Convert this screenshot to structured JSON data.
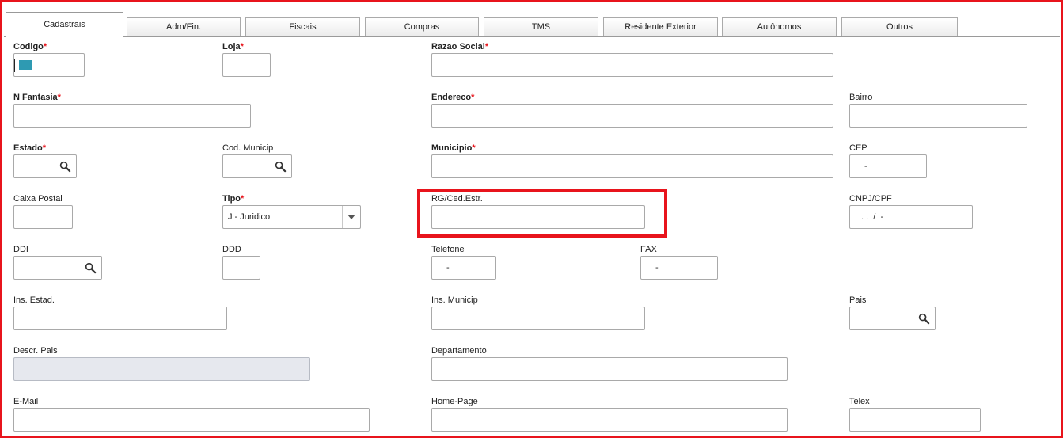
{
  "tabs": [
    {
      "label": "Cadastrais"
    },
    {
      "label": "Adm/Fin."
    },
    {
      "label": "Fiscais"
    },
    {
      "label": "Compras"
    },
    {
      "label": "TMS"
    },
    {
      "label": "Residente Exterior"
    },
    {
      "label": "Autônomos"
    },
    {
      "label": "Outros"
    }
  ],
  "active_tab": "Cadastrais",
  "required_mark": "*",
  "colors": {
    "highlight": "#e8141c",
    "required": "#e8141c",
    "codigo_swatch": "#2e9ab2"
  },
  "fields": {
    "codigo": {
      "label": "Codigo",
      "value": ""
    },
    "loja": {
      "label": "Loja",
      "value": ""
    },
    "razao_social": {
      "label": "Razao Social",
      "value": ""
    },
    "n_fantasia": {
      "label": "N Fantasia",
      "value": ""
    },
    "endereco": {
      "label": "Endereco",
      "value": ""
    },
    "bairro": {
      "label": "Bairro",
      "value": ""
    },
    "estado": {
      "label": "Estado",
      "value": ""
    },
    "cod_municip": {
      "label": "Cod. Municip",
      "value": ""
    },
    "municipio": {
      "label": "Municipio",
      "value": ""
    },
    "cep": {
      "label": "CEP",
      "value": "-"
    },
    "caixa_postal": {
      "label": "Caixa Postal",
      "value": ""
    },
    "tipo": {
      "label": "Tipo",
      "value": "J - Juridico"
    },
    "rg_ced_estr": {
      "label": "RG/Ced.Estr.",
      "value": ""
    },
    "cnpj_cpf": {
      "label": "CNPJ/CPF",
      "value": ". .  /  -"
    },
    "ddi": {
      "label": "DDI",
      "value": ""
    },
    "ddd": {
      "label": "DDD",
      "value": ""
    },
    "telefone": {
      "label": "Telefone",
      "value": "-"
    },
    "fax": {
      "label": "FAX",
      "value": "-"
    },
    "ins_estad": {
      "label": "Ins. Estad.",
      "value": ""
    },
    "ins_municip": {
      "label": "Ins. Municip",
      "value": ""
    },
    "pais": {
      "label": "Pais",
      "value": ""
    },
    "descr_pais": {
      "label": "Descr. Pais",
      "value": ""
    },
    "departamento": {
      "label": "Departamento",
      "value": ""
    },
    "email": {
      "label": "E-Mail",
      "value": ""
    },
    "home_page": {
      "label": "Home-Page",
      "value": ""
    },
    "telex": {
      "label": "Telex",
      "value": ""
    }
  }
}
